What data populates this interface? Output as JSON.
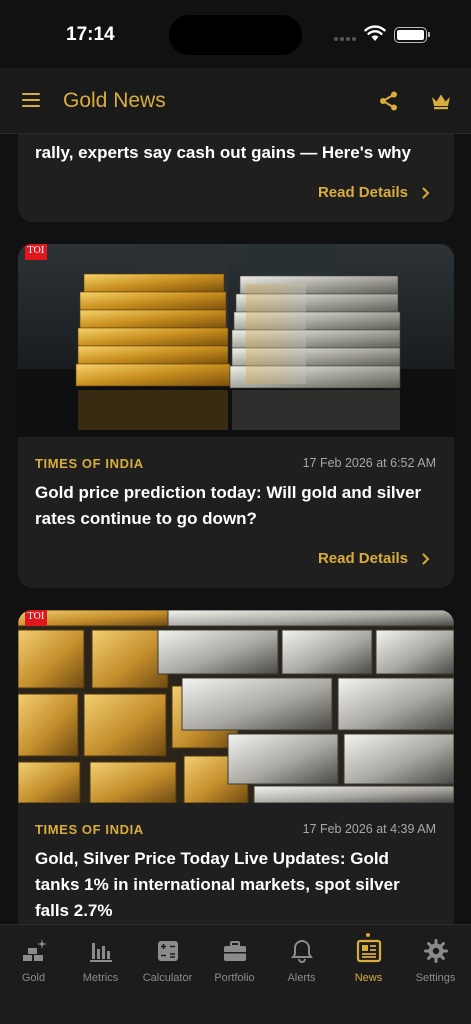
{
  "status_bar": {
    "time": "17:14"
  },
  "app_bar": {
    "title": "Gold News"
  },
  "articles": [
    {
      "source": "",
      "date": "",
      "headline": "rally, experts say cash out gains — Here's why",
      "read_label": "Read Details"
    },
    {
      "source": "TIMES OF INDIA",
      "date": "17 Feb 2026 at 6:52 AM",
      "headline": "Gold price prediction today: Will gold and silver rates continue to go down?",
      "read_label": "Read Details",
      "badge": "TOI"
    },
    {
      "source": "TIMES OF INDIA",
      "date": "17 Feb 2026 at 4:39 AM",
      "headline": "Gold, Silver Price Today Live Updates: Gold tanks 1% in international markets, spot silver falls 2.7%",
      "badge": "TOI"
    }
  ],
  "tabs": [
    {
      "label": "Gold",
      "icon": "gold-sparkle-icon"
    },
    {
      "label": "Metrics",
      "icon": "bar-chart-icon"
    },
    {
      "label": "Calculator",
      "icon": "calculator-icon"
    },
    {
      "label": "Portfolio",
      "icon": "briefcase-icon"
    },
    {
      "label": "Alerts",
      "icon": "bell-icon"
    },
    {
      "label": "News",
      "icon": "newspaper-icon",
      "active": true
    },
    {
      "label": "Settings",
      "icon": "gear-icon"
    }
  ],
  "colors": {
    "accent": "#d9ad3c",
    "background": "#111111",
    "card": "#1f1f1f",
    "inactive": "#8b8b8b"
  }
}
